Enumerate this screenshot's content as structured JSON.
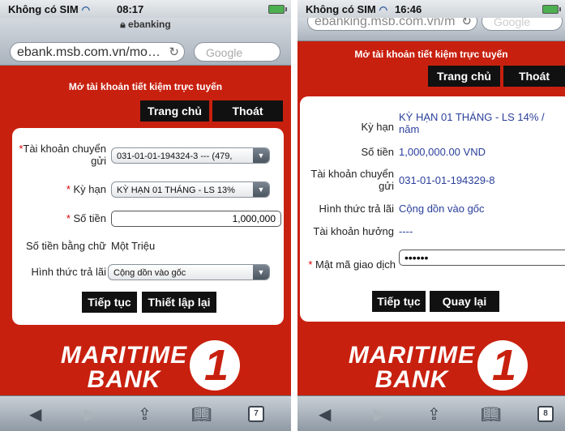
{
  "left": {
    "status": {
      "carrier": "Không có SIM",
      "time": "08:17"
    },
    "url_title": "ebanking",
    "url": "ebank.msb.com.vn/mo…",
    "search_placeholder": "Google",
    "page_title": "Mở tài khoản tiết kiệm trực tuyến",
    "nav": {
      "home": "Trang chủ",
      "exit": "Thoát"
    },
    "form": {
      "account_label": "Tài khoản chuyển gửi",
      "account_value": "031-01-01-194324-3 --- (479,",
      "term_label": "Kỳ hạn",
      "term_value": "KỲ HẠN 01 THÁNG - LS 13%",
      "amount_label": "Số tiền",
      "amount_value": "1,000,000",
      "amount_words_label": "Số tiền bằng chữ",
      "amount_words_value": "Một Triệu",
      "interest_label": "Hình thức trả lãi",
      "interest_value": "Cộng dồn vào gốc",
      "continue": "Tiếp tục",
      "reset": "Thiết lập lại"
    },
    "logo": {
      "line1": "MARITIME",
      "line2": "BANK"
    },
    "tab_count": "7"
  },
  "right": {
    "status": {
      "carrier": "Không có SIM",
      "time": "16:46"
    },
    "url": "ebanking.msb.com.vn/m",
    "search_placeholder": "Google",
    "page_title": "Mở tài khoản tiết kiệm trực tuyến",
    "nav": {
      "home": "Trang chủ",
      "exit": "Thoát"
    },
    "confirm": {
      "term_label": "Kỳ hạn",
      "term_value_1": "KỲ HẠN 01 THÁNG - LS 14% /",
      "term_value_2": "năm",
      "amount_label": "Số tiền",
      "amount_value": "1,000,000.00 VND",
      "account_label": "Tài khoản chuyển gửi",
      "account_value": "031-01-01-194329-8",
      "interest_label": "Hình thức trả lãi",
      "interest_value": "Cộng dồn vào gốc",
      "beneficiary_label": "Tài khoản hưởng",
      "beneficiary_value": "----",
      "otp_label": "Mật mã giao dịch",
      "otp_value": "••••••",
      "continue": "Tiếp tục",
      "back": "Quay lại"
    },
    "logo": {
      "line1": "MARITIME",
      "line2": "BANK"
    },
    "tab_count": "8"
  }
}
